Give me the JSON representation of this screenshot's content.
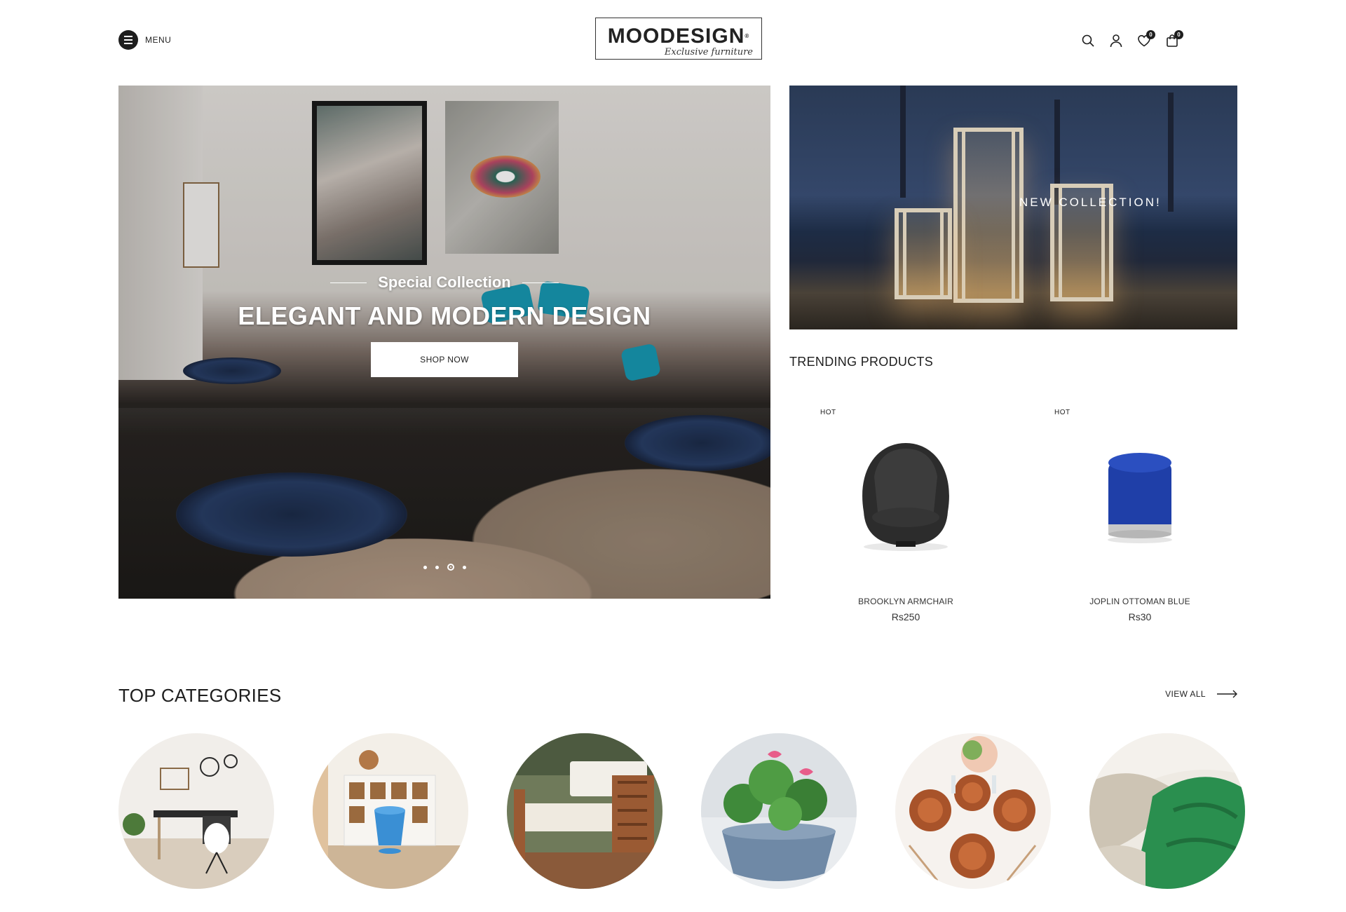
{
  "header": {
    "menu_label": "MENU",
    "logo_main": "MOODESIGN",
    "logo_reg": "®",
    "logo_sub": "Exclusive furniture",
    "wishlist_count": "0",
    "cart_count": "0"
  },
  "hero": {
    "subtitle": "Special Collection",
    "title": "ELEGANT AND MODERN DESIGN",
    "button_label": "SHOP NOW",
    "slide_count": 4,
    "active_slide": 3
  },
  "promo": {
    "text": "NEW COLLECTION!"
  },
  "trending": {
    "title": "TRENDING PRODUCTS",
    "products": [
      {
        "badge": "HOT",
        "name": "BROOKLYN ARMCHAIR",
        "price": "Rs250"
      },
      {
        "badge": "HOT",
        "name": "JOPLIN OTTOMAN BLUE",
        "price": "Rs30"
      }
    ]
  },
  "categories": {
    "title": "TOP CATEGORIES",
    "view_all_label": "VIEW ALL"
  },
  "icons": [
    "menu-icon",
    "search-icon",
    "user-icon",
    "heart-icon",
    "cart-icon",
    "arrow-right-icon"
  ]
}
